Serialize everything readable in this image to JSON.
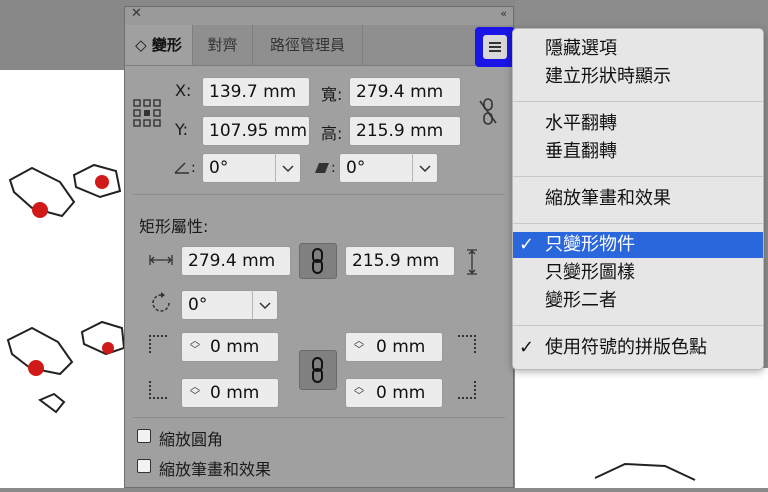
{
  "panel": {
    "close": "✕",
    "collapse": "‹‹",
    "tabs": [
      {
        "label": "◇ 變形",
        "active": true
      },
      {
        "label": "對齊",
        "active": false
      },
      {
        "label": "路徑管理員",
        "active": false
      }
    ],
    "x_label": "X:",
    "x_value": "139.7 mm",
    "y_label": "Y:",
    "y_value": "107.95 mm",
    "w_label": "寬:",
    "w_value": "279.4 mm",
    "h_label": "高:",
    "h_value": "215.9 mm",
    "angle_value": "0°",
    "shear_value": "0°",
    "rect_title": "矩形屬性:",
    "rect_w": "279.4 mm",
    "rect_h": "215.9 mm",
    "rect_rotate": "0°",
    "corners": [
      "0 mm",
      "0 mm",
      "0 mm",
      "0 mm"
    ],
    "scale_corners_label": "縮放圓角",
    "scale_strokes_label": "縮放筆畫和效果",
    "scale_corners_checked": false,
    "scale_strokes_checked": false
  },
  "menu": {
    "items": [
      {
        "label": "隱藏選項",
        "checked": false,
        "selected": false
      },
      {
        "label": "建立形狀時顯示",
        "checked": false,
        "selected": false
      },
      {
        "label": "水平翻轉",
        "checked": false,
        "selected": false
      },
      {
        "label": "垂直翻轉",
        "checked": false,
        "selected": false
      },
      {
        "label": "縮放筆畫和效果",
        "checked": false,
        "selected": false
      },
      {
        "label": "只變形物件",
        "checked": true,
        "selected": true
      },
      {
        "label": "只變形圖樣",
        "checked": false,
        "selected": false
      },
      {
        "label": "變形二者",
        "checked": false,
        "selected": false
      },
      {
        "label": "使用符號的拼版色點",
        "checked": true,
        "selected": false
      }
    ],
    "checkmark": "✓"
  },
  "colors": {
    "highlight": "#1a14e6",
    "menu_selected": "#2a66dc"
  }
}
